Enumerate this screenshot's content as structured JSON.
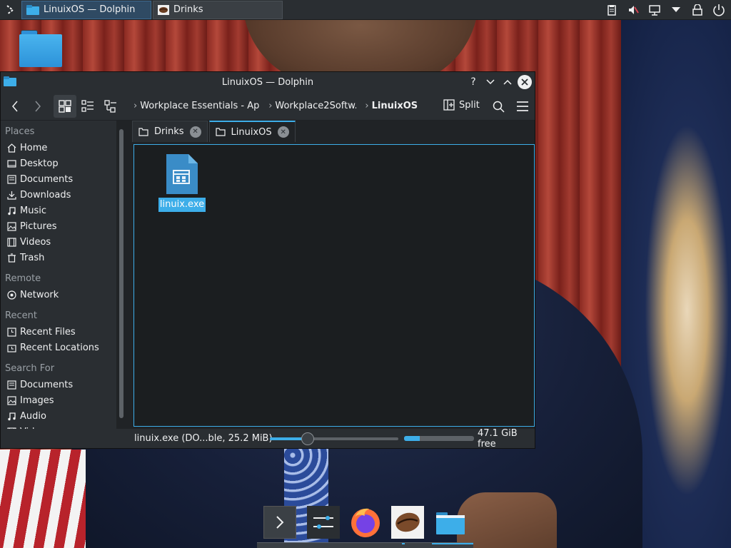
{
  "top_panel": {
    "tasks": [
      {
        "label": "LinuixOS — Dolphin",
        "active": true
      },
      {
        "label": "Drinks",
        "active": false
      }
    ]
  },
  "window": {
    "title": "LinuixOS — Dolphin",
    "help_label": "?",
    "breadcrumbs": [
      "Workplace Essentials - April",
      "Workplace2Softw...",
      "LinuixOS"
    ],
    "split_label": "Split",
    "sidebar": {
      "sections": [
        {
          "header": "Places",
          "items": [
            {
              "label": "Home",
              "icon": "home-icon"
            },
            {
              "label": "Desktop",
              "icon": "desktop-icon"
            },
            {
              "label": "Documents",
              "icon": "documents-icon"
            },
            {
              "label": "Downloads",
              "icon": "downloads-icon"
            },
            {
              "label": "Music",
              "icon": "music-icon"
            },
            {
              "label": "Pictures",
              "icon": "pictures-icon"
            },
            {
              "label": "Videos",
              "icon": "videos-icon"
            },
            {
              "label": "Trash",
              "icon": "trash-icon"
            }
          ]
        },
        {
          "header": "Remote",
          "items": [
            {
              "label": "Network",
              "icon": "network-icon"
            }
          ]
        },
        {
          "header": "Recent",
          "items": [
            {
              "label": "Recent Files",
              "icon": "recent-files-icon"
            },
            {
              "label": "Recent Locations",
              "icon": "recent-locations-icon"
            }
          ]
        },
        {
          "header": "Search For",
          "items": [
            {
              "label": "Documents",
              "icon": "documents-icon"
            },
            {
              "label": "Images",
              "icon": "images-icon"
            },
            {
              "label": "Audio",
              "icon": "audio-icon"
            },
            {
              "label": "Videos",
              "icon": "videos-icon"
            }
          ]
        }
      ]
    },
    "tabs": [
      {
        "label": "Drinks",
        "active": false
      },
      {
        "label": "LinuixOS",
        "active": true
      }
    ],
    "files": [
      {
        "name": "linuix.exe",
        "selected": true
      }
    ],
    "status": {
      "text": "linuix.exe (DO...ble, 25.2 MiB)",
      "zoom_level": 0.27,
      "space_used_fraction": 0.22,
      "free_space": "47.1 GiB free"
    }
  },
  "colors": {
    "accent": "#3daee9",
    "panel_bg": "#2a2e32",
    "view_bg": "#1b1e20"
  }
}
